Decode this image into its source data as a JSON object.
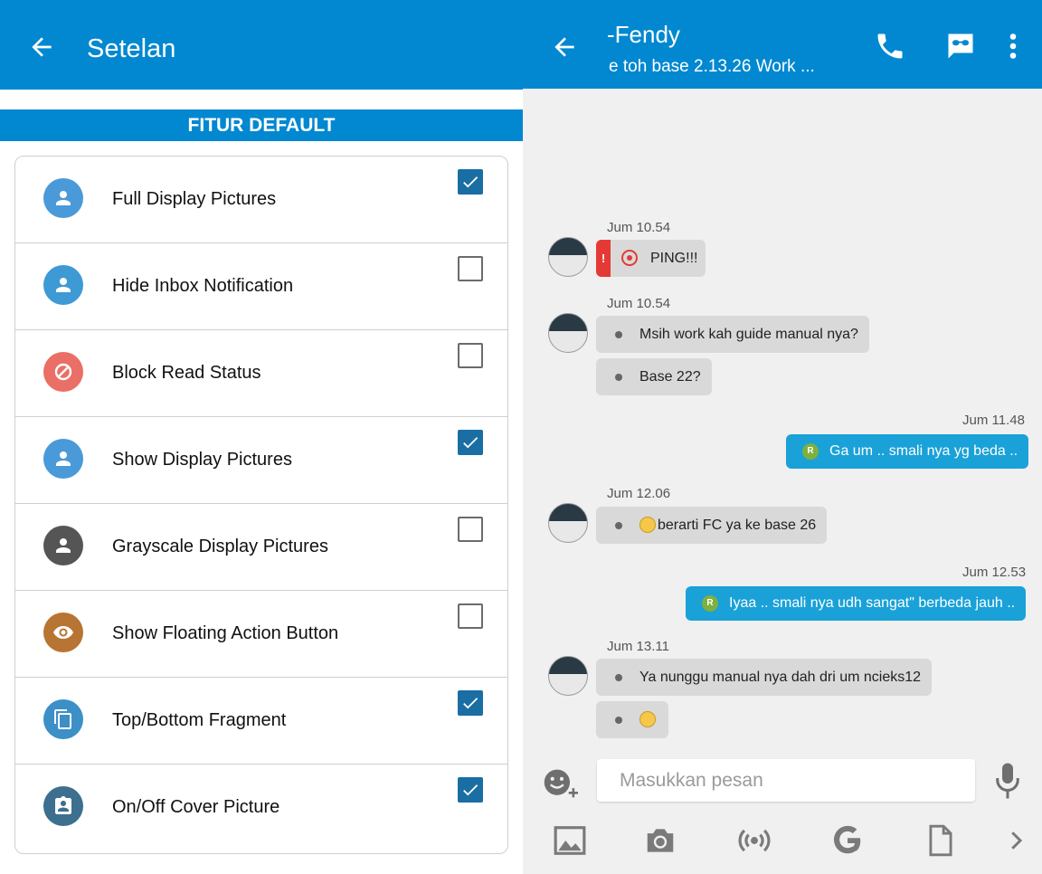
{
  "settings": {
    "title": "Setelan",
    "section_header": "FITUR DEFAULT",
    "items": [
      {
        "label": "Full Display Pictures",
        "checked": true,
        "icon": "person-icon",
        "icon_color": "#4a9ad9"
      },
      {
        "label": "Hide Inbox Notification",
        "checked": false,
        "icon": "person-icon",
        "icon_color": "#3d9ad4"
      },
      {
        "label": "Block Read Status",
        "checked": false,
        "icon": "block-icon",
        "icon_color": "#ea6f66"
      },
      {
        "label": "Show Display Pictures",
        "checked": true,
        "icon": "person-icon",
        "icon_color": "#4a9ad9"
      },
      {
        "label": "Grayscale Display Pictures",
        "checked": false,
        "icon": "person-icon",
        "icon_color": "#555555"
      },
      {
        "label": "Show Floating Action Button",
        "checked": false,
        "icon": "eye-icon",
        "icon_color": "#b87433"
      },
      {
        "label": "Top/Bottom Fragment",
        "checked": true,
        "icon": "copy-icon",
        "icon_color": "#3d8fc7"
      },
      {
        "label": "On/Off Cover Picture",
        "checked": true,
        "icon": "contact-card-icon",
        "icon_color": "#3d6f8f"
      }
    ]
  },
  "chat": {
    "name": "-Fendy",
    "status": "e toh base 2.13.26 Work ...",
    "messages": [
      {
        "time": "Jum 10.54",
        "type": "ping",
        "text": "PING!!!"
      },
      {
        "time": "Jum 10.54",
        "type": "incoming",
        "lines": [
          "Msih work kah guide manual nya?",
          "Base 22?"
        ]
      },
      {
        "time": "Jum 11.48",
        "type": "outgoing",
        "text": "Ga um .. smali nya yg beda .."
      },
      {
        "time": "Jum 12.06",
        "type": "incoming",
        "lines": [
          "berarti FC ya ke base 26"
        ]
      },
      {
        "time": "Jum 12.53",
        "type": "outgoing",
        "text": "Iyaa .. smali nya udh sangat\" berbeda jauh .."
      },
      {
        "time": "Jum 13.11",
        "type": "incoming",
        "lines": [
          "Ya nunggu manual nya dah dri um ncieks12",
          ""
        ]
      }
    ],
    "read_badge": "R",
    "ping_badge": "!",
    "input_placeholder": "Masukkan pesan"
  },
  "colors": {
    "primary": "#0288d1",
    "outgoing_bubble": "#1aa1d8",
    "incoming_bubble": "#d9d9d9",
    "checkbox_checked": "#1a6ea3"
  }
}
